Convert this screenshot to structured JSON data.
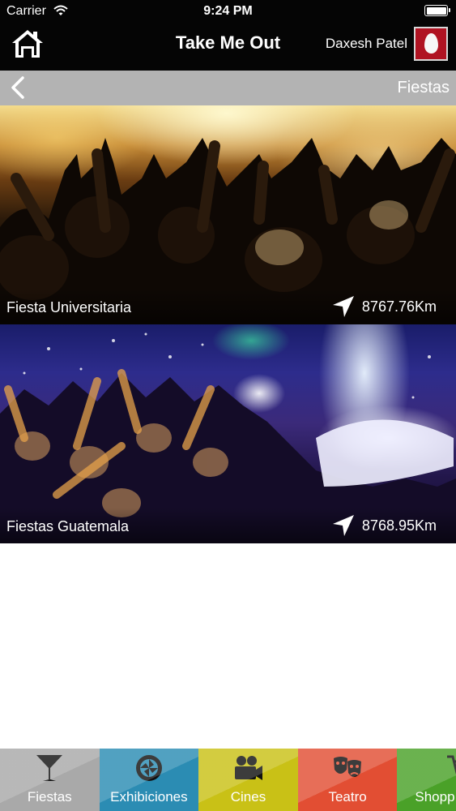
{
  "status_bar": {
    "carrier": "Carrier",
    "time": "9:24 PM"
  },
  "header": {
    "title": "Take Me Out",
    "user_name": "Daxesh Patel",
    "avatar_color": "#b01322"
  },
  "subheader": {
    "title": "Fiestas",
    "background": "#b3b3b3"
  },
  "events": [
    {
      "name": "Fiesta Universitaria",
      "distance": "8767.76Km"
    },
    {
      "name": "Fiestas Guatemala",
      "distance": "8768.95Km"
    }
  ],
  "tabs": [
    {
      "label": "Fiestas",
      "icon": "cocktail-glass-icon",
      "color": "#a9a9a9",
      "selected": true
    },
    {
      "label": "Exhibiciones",
      "icon": "camera-shutter-icon",
      "color": "#2b8cb3"
    },
    {
      "label": "Cines",
      "icon": "video-camera-icon",
      "color": "#c9c116"
    },
    {
      "label": "Teatro",
      "icon": "theater-masks-icon",
      "color": "#e24e33"
    },
    {
      "label": "Shopp",
      "icon": "shopping-cart-icon",
      "color": "#4aa128"
    }
  ]
}
